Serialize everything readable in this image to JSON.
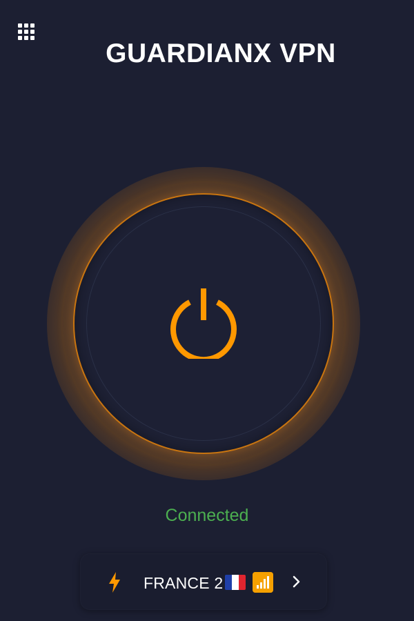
{
  "header": {
    "title": "GUARDIANX VPN",
    "menu_icon": "grid-menu-icon"
  },
  "power": {
    "icon": "power-icon",
    "accent_color": "#ff9800"
  },
  "status": {
    "text": "Connected",
    "color": "#4caf50"
  },
  "server": {
    "name": "FRANCE 2",
    "flag_icon": "france-flag-icon",
    "signal_icon": "signal-strength-icon",
    "speed_icon": "lightning-bolt-icon",
    "arrow_icon": "chevron-right-icon"
  },
  "colors": {
    "background": "#1c1f32",
    "accent": "#ff9800",
    "text": "#ffffff"
  }
}
